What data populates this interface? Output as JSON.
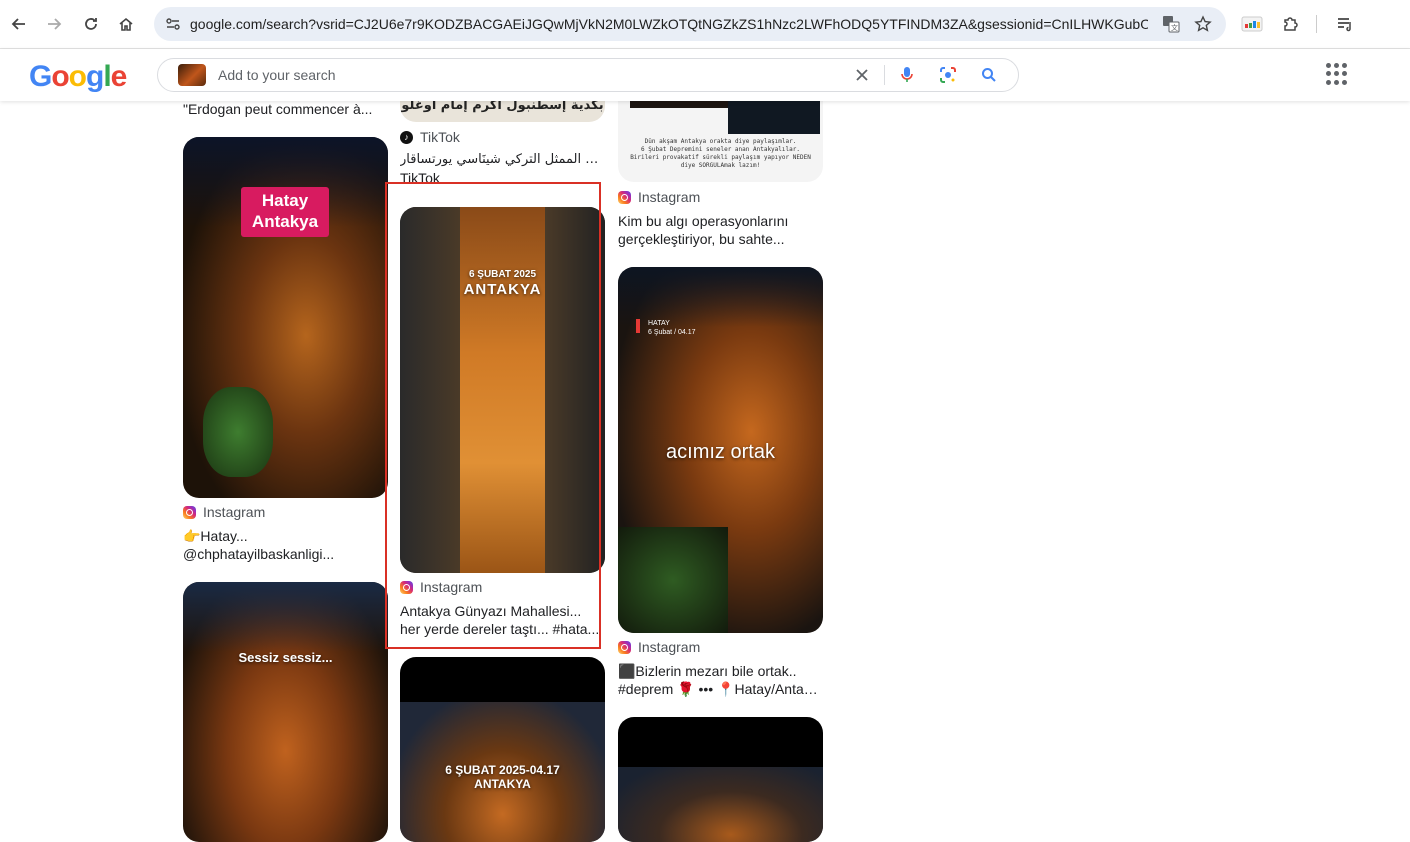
{
  "browser": {
    "url": "google.com/search?vsrid=CJ2U6e7r9KODZBACGAEiJGQwMjVkN2M0LWZkOTQtNGZkZS1hNzc2LWFhODQ5YTFINDM3ZA&gsessionid=CnILHWKGubOqFlz..."
  },
  "google": {
    "logo": "Google",
    "search_placeholder": "Add to your search"
  },
  "results": {
    "c1_top_caption": "\"Erdogan peut commencer à...",
    "c1_r1": {
      "overlay_line1": "Hatay",
      "overlay_line2": "Antakya",
      "source": "Instagram",
      "caption_line1": "👉Hatay...",
      "caption_line2": "@chphatayilbaskanligi..."
    },
    "c1_r2": {
      "overlay": "Sessiz sessiz..."
    },
    "c2_top": {
      "image_text": "بكدية إسطنبول أكرم إمام أوغلو",
      "source": "TikTok",
      "caption_line1": "وفاة الممثل التركي شينَاسي يورتساقار -",
      "caption_line2": "TikTok"
    },
    "c2_r1": {
      "overlay_line1": "6 ŞUBAT 2025",
      "overlay_line2": "ANTAKYA",
      "source": "Instagram",
      "caption_line1": "Antakya Günyazı Mahallesi...",
      "caption_line2": "her yerde dereler taştı... #hata..."
    },
    "c2_r2": {
      "overlay_line1": "6 ŞUBAT 2025-04.17",
      "overlay_line2": "ANTAKYA"
    },
    "c3_top": {
      "image_text_line1": "Dün akşam Antakya orakta diye paylaşımlar.",
      "image_text_line2": "6 Şubat Depremini seneler anan Antakyalılar.",
      "image_text_line3": "Birileri provakatif sürekli paylaşım yapıyor NEDEN",
      "image_text_line4": "diye SORGULAmak lazım!",
      "source": "Instagram",
      "caption_line1": "Kim bu algı operasyonlarını",
      "caption_line2": "gerçekleştiriyor, bu sahte..."
    },
    "c3_r1": {
      "overlay_tag_line1": "HATAY",
      "overlay_tag_line2": "6 Şubat / 04.17",
      "overlay_main": "acımız ortak",
      "source": "Instagram",
      "caption_line1": "⬛Bizlerin mezarı bile ortak..",
      "caption_line2": "#deprem 🌹 ••• 📍Hatay/Antaky..."
    }
  },
  "colors": {
    "highlight_border": "#d93025",
    "google_blue": "#4285F4",
    "google_red": "#EA4335",
    "google_yellow": "#FBBC05",
    "google_green": "#34A853"
  }
}
